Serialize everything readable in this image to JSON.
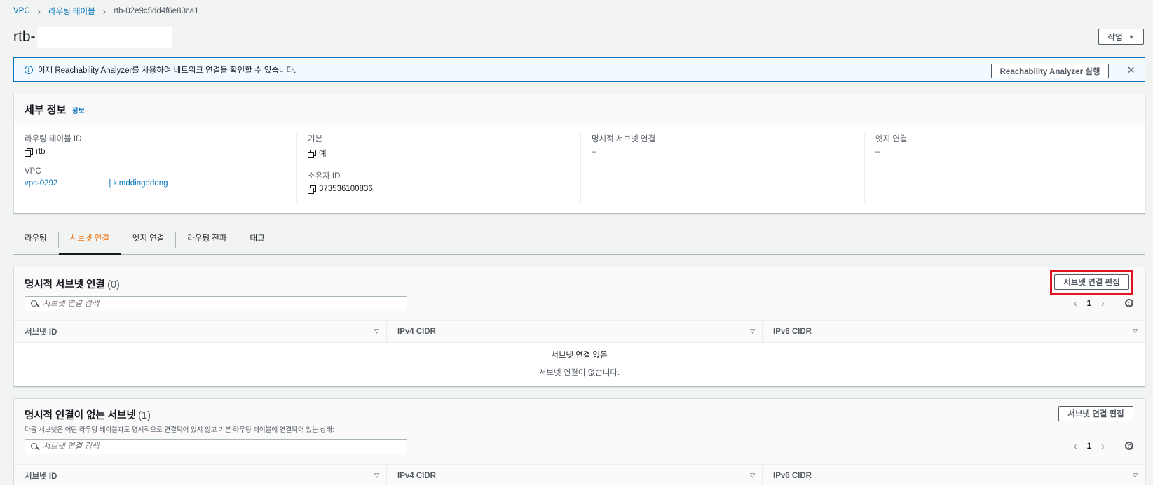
{
  "breadcrumb": {
    "items": [
      {
        "label": "VPC"
      },
      {
        "label": "라우팅 테이블"
      }
    ],
    "current": "rtb-02e9c5dd4f6e83ca1"
  },
  "header": {
    "title": "rtb-",
    "actions_label": "작업"
  },
  "banner": {
    "text": "이제 Reachability Analyzer를 사용하여 네트워크 연결을 확인할 수 있습니다.",
    "button_label": "Reachability Analyzer 실행",
    "close_icon": "×"
  },
  "details": {
    "title": "세부 정보",
    "info_link": "정보",
    "route_table_id_label": "라우팅 테이블 ID",
    "route_table_id": "rtb",
    "vpc_label": "VPC",
    "vpc_id": "vpc-0292",
    "vpc_name": "| kimddingddong",
    "main_label": "기본",
    "main_value": "예",
    "owner_label": "소유자 ID",
    "owner_value": "373536100836",
    "explicit_subnet_label": "명시적 서브넷 연결",
    "explicit_subnet_value": "–",
    "edge_label": "엣지 연결",
    "edge_value": "–"
  },
  "tabs": [
    {
      "label": "라우팅",
      "active": false
    },
    {
      "label": "서브넷 연결",
      "active": true
    },
    {
      "label": "엣지 연결",
      "active": false
    },
    {
      "label": "라우팅 전파",
      "active": false
    },
    {
      "label": "태그",
      "active": false
    }
  ],
  "explicit_panel": {
    "title": "명시적 서브넷 연결",
    "count": "(0)",
    "edit_button": "서브넷 연결 편집",
    "search_placeholder": "서브넷 연결 검색",
    "page": "1",
    "columns": [
      "서브넷 ID",
      "IPv4 CIDR",
      "IPv6 CIDR"
    ],
    "empty_title": "서브넷 연결 없음",
    "empty_desc": "서브넷 연결이 없습니다."
  },
  "implicit_panel": {
    "title": "명시적 연결이 없는 서브넷",
    "count": "(1)",
    "description": "다음 서브넷은 어떤 라우팅 테이블과도 명시적으로 연결되어 있지 않고 기본 라우팅 테이블에 연결되어 있는 상태:",
    "edit_button": "서브넷 연결 편집",
    "search_placeholder": "서브넷 연결 검색",
    "page": "1",
    "columns": [
      "서브넷 ID",
      "IPv4 CIDR",
      "IPv6 CIDR"
    ]
  },
  "colors": {
    "link": "#0073bb",
    "active_tab": "#ec7211",
    "highlight": "#e0131f",
    "banner_bg": "#f1faff"
  },
  "icons": {
    "breadcrumb_sep": "chevron-right-icon",
    "actions_caret": "caret-down-icon",
    "banner_info": "info-icon",
    "banner_close": "close-icon",
    "copy": "copy-icon",
    "search": "search-icon",
    "pager_prev": "chevron-left-icon",
    "pager_next": "chevron-right-icon",
    "settings": "gear-icon",
    "sort": "sort-down-icon"
  }
}
